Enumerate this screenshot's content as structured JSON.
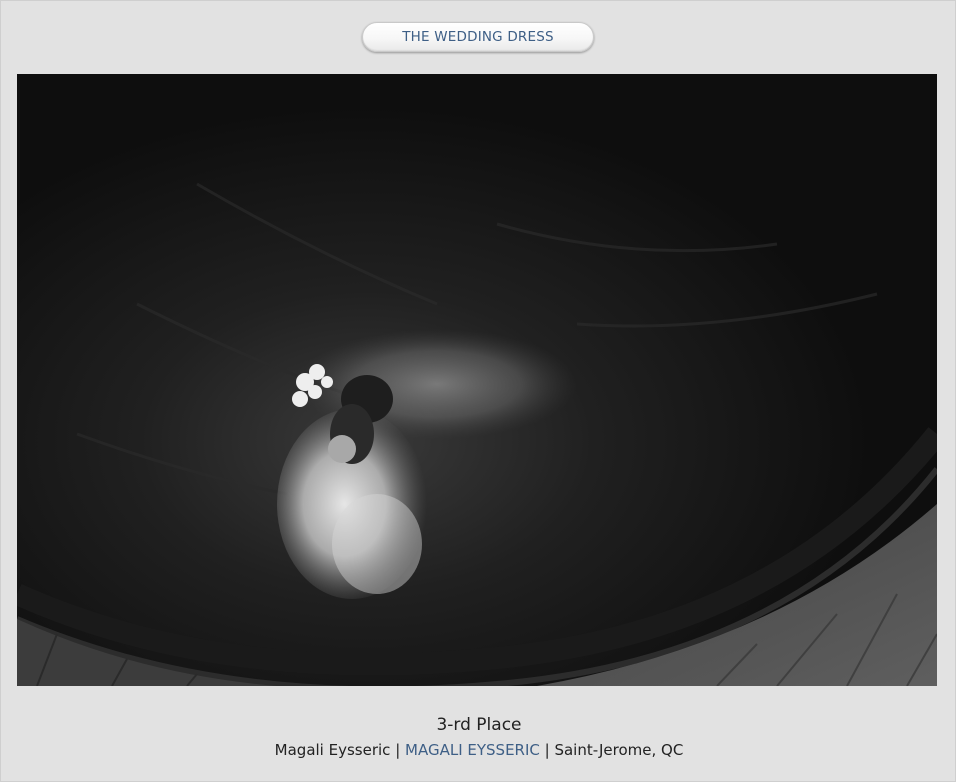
{
  "category": {
    "label": "THE WEDDING DRESS"
  },
  "photo": {
    "title": "Bride on spiral staircase, black and white"
  },
  "result": {
    "place": "3-rd Place",
    "photographer_name": "Magali Eysseric",
    "separator_1": " | ",
    "studio_link": "MAGALI EYSSERIC",
    "separator_2": " | ",
    "location": "Saint-Jerome, QC"
  },
  "colors": {
    "background": "#e2e2e2",
    "link": "#3e5f86",
    "text": "#222222"
  }
}
